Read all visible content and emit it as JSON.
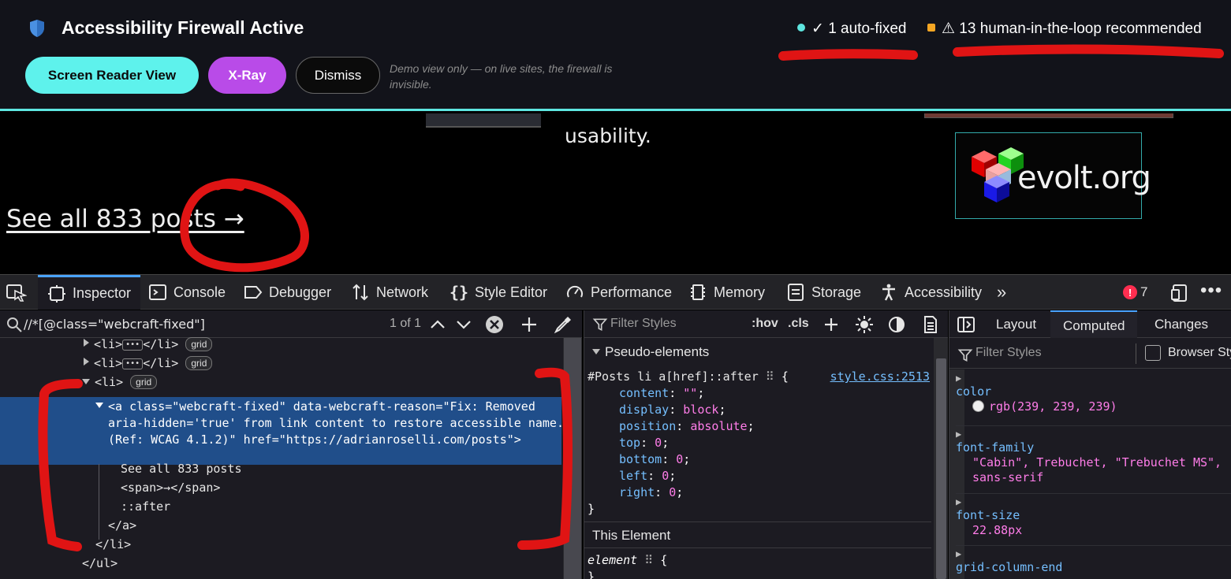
{
  "banner": {
    "title": "Accessibility Firewall Active",
    "stats": [
      {
        "text": "✓ 1 auto-fixed",
        "color": "#5ee6e0"
      },
      {
        "text": "⚠ 13 human-in-the-loop recommended",
        "color": "#f5a623"
      }
    ],
    "buttons": {
      "screen_reader": "Screen Reader View",
      "xray": "X-Ray",
      "dismiss": "Dismiss"
    },
    "note": "Demo view only — on live sites, the firewall is invisible."
  },
  "page": {
    "usability_text": "usability.",
    "logo_text": "evolt.org",
    "see_all_link": "See all 833 posts →"
  },
  "devtools": {
    "tabs": [
      "Inspector",
      "Console",
      "Debugger",
      "Network",
      "Style Editor",
      "Performance",
      "Memory",
      "Storage",
      "Accessibility"
    ],
    "active_tab": "Inspector",
    "error_count": "7",
    "search": {
      "query": "//*[@class=\"webcraft-fixed\"]",
      "result_count": "1 of 1"
    },
    "tree": {
      "li_1": "<li>",
      "li_1_end": "</li>",
      "li_badge": "grid",
      "li_open": "<li>",
      "selected_element": "<a class=\"webcraft-fixed\" data-webcraft-reason=\"Fix: Removed aria-hidden='true' from link content to restore accessible name. (Ref: WCAG 4.1.2)\" href=\"https://adrianroselli.com/posts\">",
      "text_node": "See all 833 posts",
      "span_node": "<span>→</span>",
      "pseudo": "::after",
      "a_close": "</a>",
      "li_close": "</li>",
      "ul_close": "</ul>"
    },
    "rules": {
      "filter_placeholder": "Filter Styles",
      "hov": ":hov",
      "cls": ".cls",
      "pseudo_heading": "Pseudo-elements",
      "selector": "#Posts li a[href]::after",
      "source": "style.css:2513",
      "declarations": [
        {
          "prop": "content",
          "val": "\"\""
        },
        {
          "prop": "display",
          "val": "block"
        },
        {
          "prop": "position",
          "val": "absolute"
        },
        {
          "prop": "top",
          "val": "0"
        },
        {
          "prop": "bottom",
          "val": "0"
        },
        {
          "prop": "left",
          "val": "0"
        },
        {
          "prop": "right",
          "val": "0"
        }
      ],
      "close_brace": "}",
      "this_element_heading": "This Element",
      "element_selector": "element"
    },
    "side": {
      "tabs": [
        "Layout",
        "Computed",
        "Changes"
      ],
      "active_tab": "Computed",
      "filter_placeholder": "Filter Styles",
      "browser_styles": "Browser Styles",
      "computed": [
        {
          "name": "color",
          "value": "rgb(239, 239, 239)"
        },
        {
          "name": "font-family",
          "value": "\"Cabin\", Trebuchet, \"Trebuchet MS\",",
          "value2": "sans-serif"
        },
        {
          "name": "font-size",
          "value": "22.88px"
        },
        {
          "name": "grid-column-end",
          "value": ""
        }
      ]
    }
  },
  "colors": {
    "accent": "#5ee6e0",
    "xray": "#b94be8",
    "selection": "#204e8a",
    "annotation": "#e01414"
  }
}
